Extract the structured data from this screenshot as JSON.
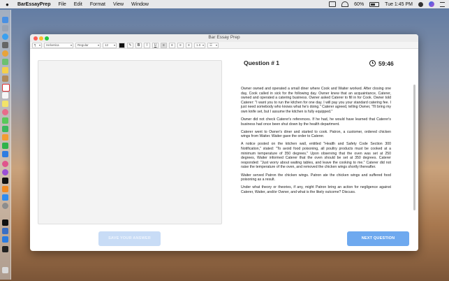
{
  "menubar": {
    "app_name": "BarEssayPrep",
    "menus": [
      "File",
      "Edit",
      "Format",
      "View",
      "Window"
    ],
    "battery": "60%",
    "clock": "Tue 1:45 PM"
  },
  "window": {
    "title": "Bar Essay Prep"
  },
  "toolbar": {
    "paragraph_style": "¶",
    "font_family": "Helvetica",
    "font_weight": "Regular",
    "font_size": "12",
    "bold": "B",
    "italic": "I",
    "underline": "U",
    "line_spacing": "1.0",
    "list_style": "☰"
  },
  "question": {
    "title": "Question # 1",
    "timer": "59:46",
    "paragraphs": [
      "Owner owned and operated a small diner where Cook and Waiter worked.  After closing one day, Cook called in sick for the following day.  Owner knew that an  acquaintance, Caterer, owned and operated a catering business.  Owner asked Caterer to fill in for Cook.  Owner told Caterer:  \"I want you to run the kitchen for one day.  I will pay you your standard catering fee.  I just need somebody who knows what he's doing.\"  Caterer agreed, telling Owner, \"I'll bring my own knife set, but I assume the kitchen is fully equipped.\"",
      "Owner did not check Caterer's references.  If he had, he would have learned that Caterer's business had once been shut down by the health department.",
      "Caterer went to Owner's diner and started to cook.  Patron, a customer, ordered chicken wings from Waiter.  Waiter  gave the order to Caterer.",
      "A notice posted on the kitchen wall, entitled \"Health and Safety Code Section 300 Notification,\" stated:  \"To avoid food poisoning, all poultry products must be cooked at a minimum temperature of 350 degrees.\"  Upon observing that the oven was set at 250 degrees, Waiter informed Caterer that the oven should be set at 350 degrees.  Caterer responded:  \"Just worry about waiting tables, and leave the cooking to me.\"  Caterer did not raise the temperature of the oven, and removed the chicken wings shortly thereafter.",
      "Waiter served Patron the chicken wings.  Patron ate the chicken wings and suffered food poisoning as a result.",
      "Under what theory or theories, if any, might Patron bring an action for negligence against Caterer, Waiter, and/or Owner, and what is the likely outcome?  Discuss."
    ]
  },
  "buttons": {
    "save": "Save your answer",
    "next": "Next question"
  },
  "colors": {
    "accent": "#6ea9ef",
    "accent_disabled": "#c8dcf6"
  }
}
